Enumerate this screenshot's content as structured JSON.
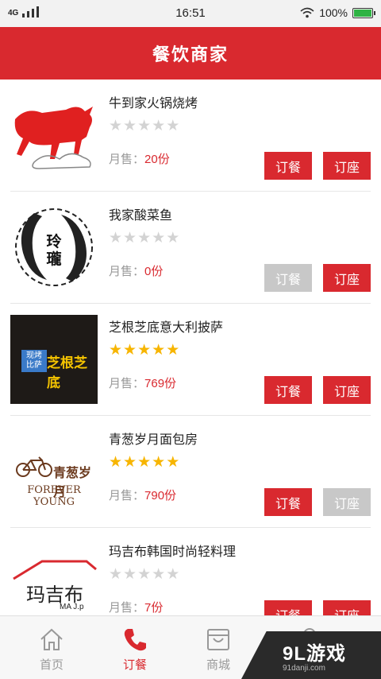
{
  "status_bar": {
    "network": "4G",
    "time": "16:51",
    "battery": "100%",
    "battery_level": 1.0
  },
  "header": {
    "title": "餐饮商家"
  },
  "colors": {
    "brand_red": "#d9292f",
    "star_on": "#f7b500",
    "star_off": "#d3d3d3",
    "disabled": "#c8c8c8"
  },
  "restaurants": [
    {
      "name": "牛到家火锅烧烤",
      "rating": 0,
      "sales_label": "月售：",
      "sales_value": "20份",
      "order_label": "订餐",
      "seat_label": "订座",
      "order_enabled": true,
      "seat_enabled": true,
      "logo_icon": "red-bull-icon"
    },
    {
      "name": "我家酸菜鱼",
      "rating": 0,
      "sales_label": "月售：",
      "sales_value": "0份",
      "order_label": "订餐",
      "seat_label": "订座",
      "order_enabled": false,
      "seat_enabled": true,
      "logo_icon": "koi-fish-icon",
      "logo_text": "玲 瓏"
    },
    {
      "name": "芝根芝底意大利披萨",
      "rating": 5,
      "sales_label": "月售：",
      "sales_value": "769份",
      "order_label": "订餐",
      "seat_label": "订座",
      "order_enabled": true,
      "seat_enabled": true,
      "logo_icon": "pizza-logo-icon",
      "logo_text_small": "现烤 比萨",
      "logo_text": "芝根芝底"
    },
    {
      "name": "青葱岁月面包房",
      "rating": 5,
      "sales_label": "月售：",
      "sales_value": "790份",
      "order_label": "订餐",
      "seat_label": "订座",
      "order_enabled": true,
      "seat_enabled": false,
      "logo_icon": "bicycle-icon",
      "logo_text": "青葱岁月",
      "logo_text_en": "FOREVER YOUNG"
    },
    {
      "name": "玛吉布韩国时尚轻料理",
      "rating": 0,
      "sales_label": "月售：",
      "sales_value": "7份",
      "order_label": "订餐",
      "seat_label": "订座",
      "order_enabled": true,
      "seat_enabled": true,
      "logo_icon": "house-roof-icon",
      "logo_text": "玛吉布",
      "logo_text_en": "MA J.p"
    }
  ],
  "tabbar": {
    "tabs": [
      {
        "label": "首页",
        "icon": "home-icon",
        "active": false
      },
      {
        "label": "订餐",
        "icon": "phone-icon",
        "active": true
      },
      {
        "label": "商城",
        "icon": "bag-icon",
        "active": false
      },
      {
        "label": "",
        "icon": "user-icon",
        "active": false
      }
    ]
  },
  "watermark": {
    "top": "9L游戏",
    "bottom": "91danji.com"
  }
}
